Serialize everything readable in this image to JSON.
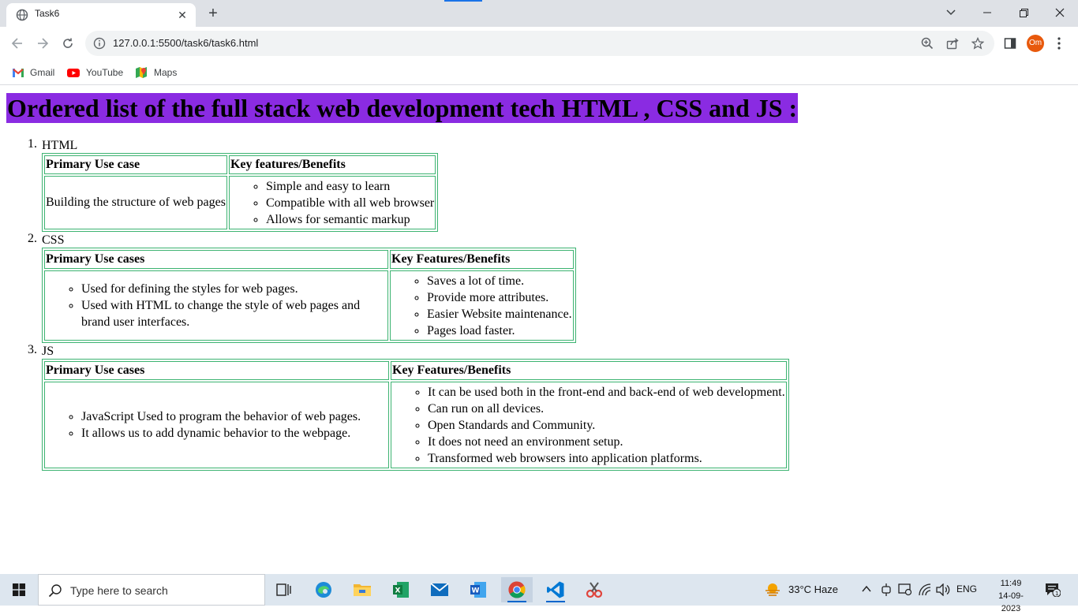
{
  "browser": {
    "tab_title": "Task6",
    "url": "127.0.0.1:5500/task6/task6.html",
    "profile_initials": "Om",
    "bookmarks": [
      {
        "label": "Gmail",
        "icon": "gmail-icon"
      },
      {
        "label": "YouTube",
        "icon": "youtube-icon"
      },
      {
        "label": "Maps",
        "icon": "maps-icon"
      }
    ]
  },
  "page": {
    "heading": "Ordered list of the full stack web development tech HTML , CSS and JS :",
    "heading_bg": "#8a2be2",
    "table_border_color": "#3cb371",
    "items": [
      {
        "marker": "1.",
        "title": "HTML",
        "col1_header": "Primary Use case",
        "col2_header": "Key features/Benefits",
        "use_case_text": "Building the structure of web pages",
        "features": [
          "Simple and easy to learn",
          "Compatible with all web browser",
          "Allows for semantic markup"
        ]
      },
      {
        "marker": "2.",
        "title": "CSS",
        "col1_header": "Primary Use cases",
        "col2_header": "Key Features/Benefits",
        "use_cases": [
          "Used for defining the styles for web pages.",
          "Used with HTML to change the style of web pages and brand user interfaces."
        ],
        "features": [
          "Saves a lot of time.",
          "Provide more attributes.",
          "Easier Website maintenance.",
          "Pages load faster."
        ]
      },
      {
        "marker": "3.",
        "title": "JS",
        "col1_header": "Primary Use cases",
        "col2_header": "Key Features/Benefits",
        "use_cases": [
          "JavaScript Used to program the behavior of web pages.",
          "It allows us to add dynamic behavior to the webpage."
        ],
        "features": [
          "It can be used both in the front-end and back-end of web development.",
          "Can run on all devices.",
          "Open Standards and Community.",
          "It does not need an environment setup.",
          "Transformed web browsers into application platforms."
        ]
      }
    ]
  },
  "taskbar": {
    "search_placeholder": "Type here to search",
    "weather": "33°C  Haze",
    "language": "ENG",
    "time": "11:49",
    "date": "14-09-2023",
    "notification_count": "1"
  }
}
